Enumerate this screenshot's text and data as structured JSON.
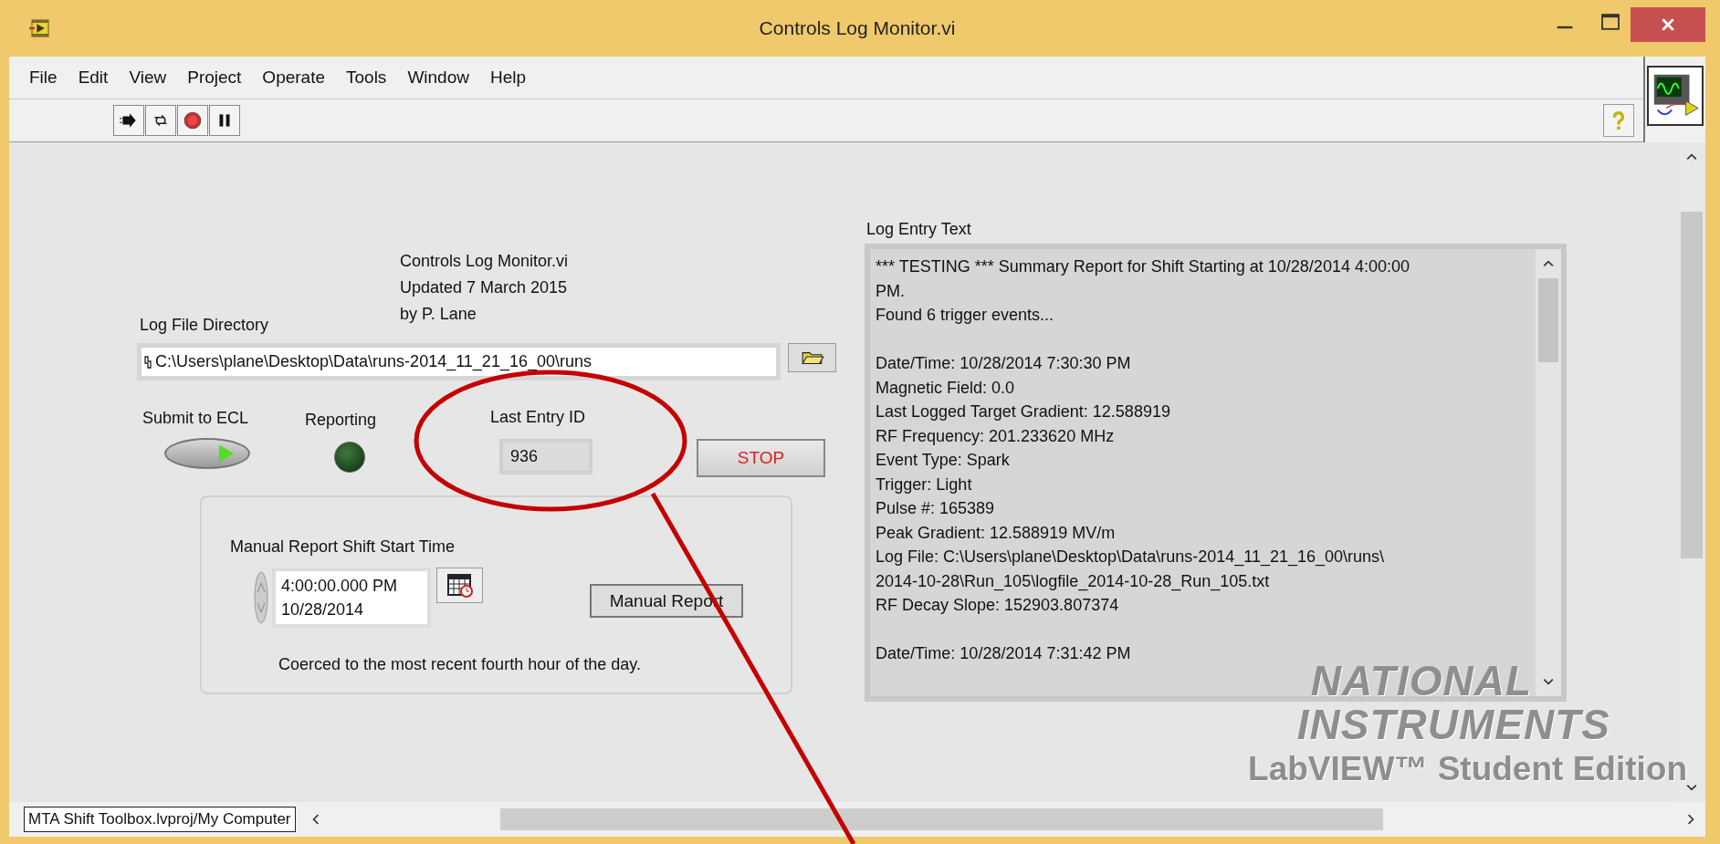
{
  "window": {
    "title": "Controls Log Monitor.vi"
  },
  "menu": [
    "File",
    "Edit",
    "View",
    "Project",
    "Operate",
    "Tools",
    "Window",
    "Help"
  ],
  "panel": {
    "header_lines": [
      "Controls Log Monitor.vi",
      "Updated 7 March 2015",
      "by P. Lane"
    ],
    "log_directory": {
      "label": "Log File Directory",
      "value": "C:\\Users\\plane\\Desktop\\Data\\runs-2014_11_21_16_00\\runs"
    },
    "submit": {
      "label": "Submit to ECL",
      "on": true
    },
    "reporting": {
      "label": "Reporting",
      "on": false
    },
    "last_entry": {
      "label": "Last Entry ID",
      "value": "936"
    },
    "stop_button": "STOP",
    "manual": {
      "label": "Manual Report Shift Start Time",
      "time": "4:00:00.000 PM",
      "date": "10/28/2014",
      "button": "Manual Report",
      "note": "Coerced to the most recent fourth hour of the day."
    },
    "log": {
      "label": "Log Entry Text",
      "groups": [
        [
          "*** TESTING *** Summary Report for Shift Starting at 10/28/2014 4:00:00",
          "PM.",
          "Found 6 trigger events..."
        ],
        [
          "Date/Time: 10/28/2014 7:30:30 PM",
          "Magnetic Field: 0.0",
          "Last Logged Target Gradient: 12.588919",
          "RF Frequency: 201.233620 MHz",
          "Event Type: Spark",
          "Trigger: Light",
          "Pulse #: 165389",
          "Peak Gradient: 12.588919 MV/m",
          "Log File: C:\\Users\\plane\\Desktop\\Data\\runs-2014_11_21_16_00\\runs\\",
          "2014-10-28\\Run_105\\logfile_2014-10-28_Run_105.txt",
          "RF Decay Slope: 152903.807374"
        ],
        [
          "Date/Time: 10/28/2014 7:31:42 PM"
        ]
      ]
    }
  },
  "watermark": {
    "company_lines": [
      "NATIONAL",
      "INSTRUMENTS"
    ],
    "product": "LabVIEW™ Student Edition"
  },
  "status_bar": {
    "context": "MTA Shift Toolbox.lvproj/My Computer"
  }
}
